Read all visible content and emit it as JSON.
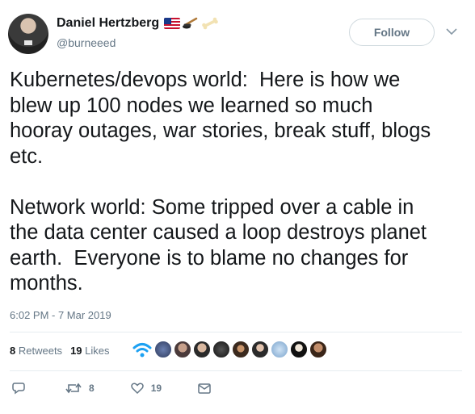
{
  "author": {
    "display_name": "Daniel Hertzberg",
    "username": "@burneeed",
    "name_emojis": [
      "us-flag-icon",
      "hockey-stick-puck-icon",
      "bone-icon"
    ]
  },
  "follow_button": {
    "label": "Follow"
  },
  "tweet": {
    "text": "Kubernetes/devops world:  Here is how we\nblew up 100 nodes we learned so much\nhooray outages, war stories, break stuff, blogs\netc.\n\nNetwork world: Some tripped over a cable in\nthe data center caused a loop destroys planet\nearth.  Everyone is to blame no changes for\nmonths.",
    "timestamp": "6:02 PM - 7 Mar 2019"
  },
  "stats": {
    "retweets_count": "8",
    "retweets_label": "Retweets",
    "likes_count": "19",
    "likes_label": "Likes"
  },
  "actions": {
    "retweet_count": "8",
    "like_count": "19"
  },
  "colors": {
    "text": "#14171a",
    "secondary": "#657786",
    "border": "#e6ecf0",
    "link_blue": "#1da1f2"
  }
}
